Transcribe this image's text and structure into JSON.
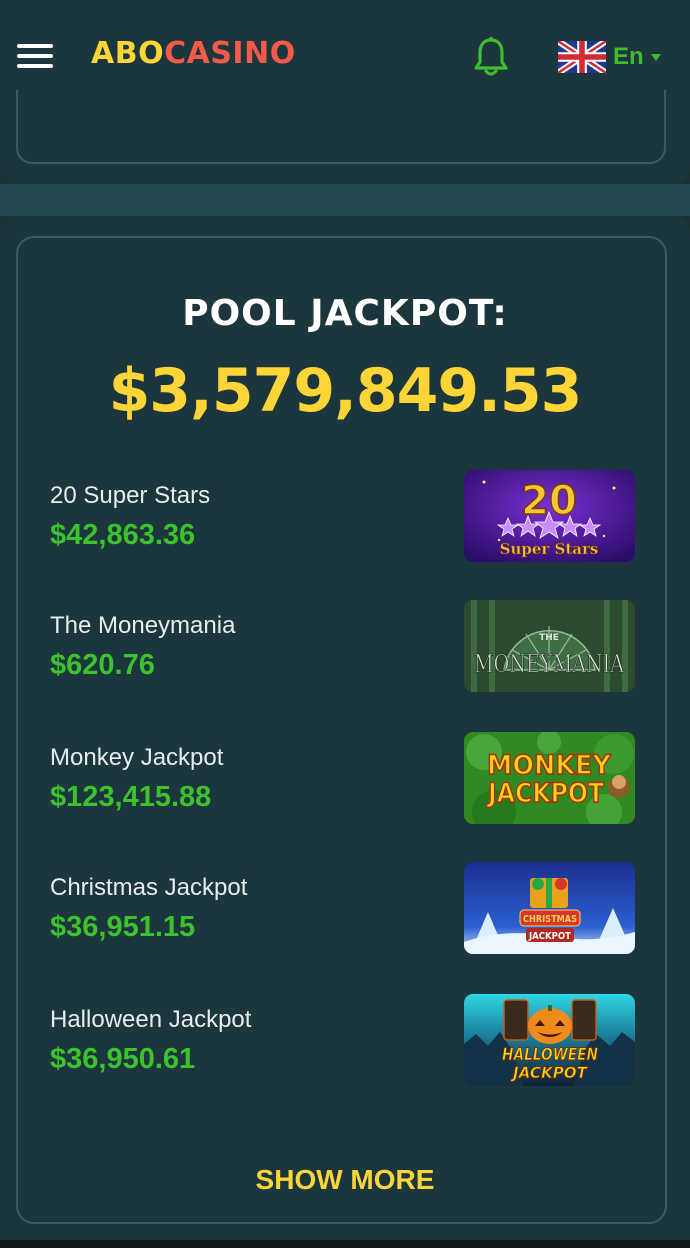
{
  "header": {
    "logo_part1": "ABO",
    "logo_part2": "CASINO",
    "language_code": "En",
    "menu_icon": "hamburger-menu-icon",
    "notification_icon": "bell-icon",
    "flag_icon": "uk-flag-icon"
  },
  "jackpot": {
    "title": "POOL JACKPOT:",
    "amount": "$3,579,849.53",
    "games": [
      {
        "name": "20 Super Stars",
        "amount": "$42,863.36",
        "thumb_text": "20",
        "thumb_subtext": "Super Stars"
      },
      {
        "name": "The Moneymania",
        "amount": "$620.76",
        "thumb_text": "MONEYMANIA",
        "thumb_subtext": "THE"
      },
      {
        "name": "Monkey Jackpot",
        "amount": "$123,415.88",
        "thumb_text": "MONKEY",
        "thumb_subtext": "JACKPOT"
      },
      {
        "name": "Christmas Jackpot",
        "amount": "$36,951.15",
        "thumb_text": "CHRISTMAS",
        "thumb_subtext": "JACKPOT"
      },
      {
        "name": "Halloween Jackpot",
        "amount": "$36,950.61",
        "thumb_text": "HALLOWEEN",
        "thumb_subtext": "JACKPOT"
      }
    ],
    "show_more_label": "SHOW MORE"
  },
  "colors": {
    "background": "#1c363d",
    "brand_yellow": "#fdd536",
    "brand_red": "#f25a4a",
    "amount_green": "#3cc22d",
    "card_border": "#3d5a60"
  }
}
